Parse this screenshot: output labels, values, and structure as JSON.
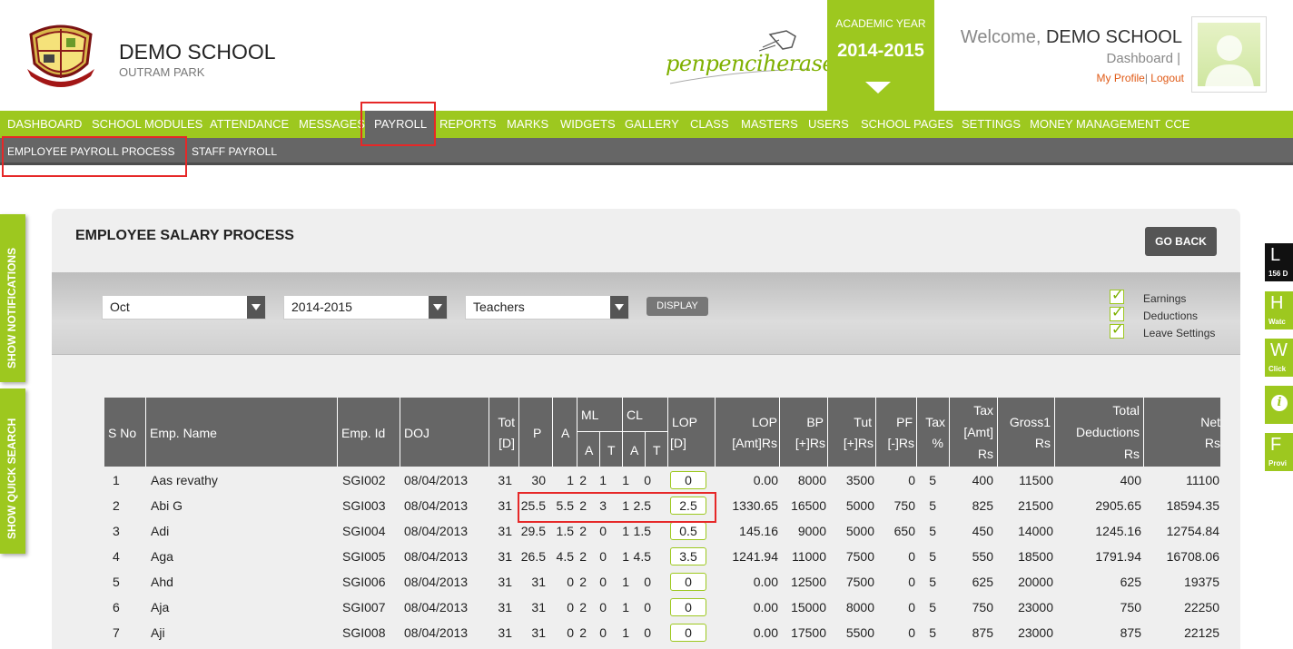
{
  "header": {
    "school_name": "DEMO SCHOOL",
    "school_sub": "OUTRAM PARK",
    "brand": "penpenciheraser",
    "academic_label": "ACADEMIC YEAR",
    "academic_year": "2014-2015",
    "welcome_prefix": "Welcome,",
    "welcome_name": "DEMO SCHOOL",
    "dashboard_link": "Dashboard",
    "my_profile": "My Profile",
    "logout": "Logout"
  },
  "nav": {
    "items": [
      "DASHBOARD",
      "SCHOOL MODULES",
      "ATTENDANCE",
      "MESSAGES",
      "PAYROLL",
      "REPORTS",
      "MARKS",
      "WIDGETS",
      "GALLERY",
      "CLASS",
      "MASTERS",
      "USERS",
      "SCHOOL PAGES",
      "SETTINGS",
      "MONEY MANAGEMENT",
      "CCE"
    ],
    "active": "PAYROLL",
    "sub_items": [
      "EMPLOYEE PAYROLL PROCESS",
      "STAFF PAYROLL"
    ]
  },
  "side_tabs": {
    "notifications": "SHOW NOTIFICATIONS",
    "quick_search": "SHOW QUICK SEARCH"
  },
  "right_tabs": [
    {
      "letter": "L",
      "text": "156 D"
    },
    {
      "letter": "H",
      "text": "Watc"
    },
    {
      "letter": "W",
      "text": "Click"
    },
    {
      "letter": "i",
      "text": ""
    },
    {
      "letter": "F",
      "text": "Provi"
    }
  ],
  "panel": {
    "title": "EMPLOYEE SALARY PROCESS",
    "go_back": "GO BACK",
    "month": "Oct",
    "year": "2014-2015",
    "category": "Teachers",
    "display": "DISPLAY",
    "checkboxes": [
      "Earnings",
      "Deductions",
      "Leave Settings"
    ]
  },
  "table": {
    "headers": {
      "sno": "S No",
      "name": "Emp. Name",
      "empid": "Emp. Id",
      "doj": "DOJ",
      "tot1": "Tot",
      "tot2": "[D]",
      "p": "P",
      "a": "A",
      "ml": "ML",
      "cl": "CL",
      "ml_a": "A",
      "ml_t": "T",
      "cl_a": "A",
      "cl_t": "T",
      "lop1": "LOP",
      "lop2": "[D]",
      "lopamt1": "LOP",
      "lopamt2": "[Amt]Rs",
      "bp1": "BP",
      "bp2": "[+]Rs",
      "tut1": "Tut",
      "tut2": "[+]Rs",
      "pf1": "PF",
      "pf2": "[-]Rs",
      "tax1": "Tax",
      "tax2": "%",
      "taxamt1": "Tax",
      "taxamt2": "[Amt]",
      "taxamt3": "Rs",
      "gross1": "Gross1",
      "gross2": "Rs",
      "ded1": "Total",
      "ded2": "Deductions",
      "ded3": "Rs",
      "net1": "Net",
      "net2": "Rs"
    },
    "rows": [
      [
        "1",
        "Aas revathy",
        "SGI002",
        "08/04/2013",
        "31",
        "30",
        "1",
        "2",
        "1",
        "1",
        "0",
        "0",
        "0.00",
        "8000",
        "3500",
        "0",
        "5",
        "400",
        "11500",
        "400",
        "11100"
      ],
      [
        "2",
        "Abi G",
        "SGI003",
        "08/04/2013",
        "31",
        "25.5",
        "5.5",
        "2",
        "3",
        "1",
        "2.5",
        "2.5",
        "1330.65",
        "16500",
        "5000",
        "750",
        "5",
        "825",
        "21500",
        "2905.65",
        "18594.35"
      ],
      [
        "3",
        "Adi",
        "SGI004",
        "08/04/2013",
        "31",
        "29.5",
        "1.5",
        "2",
        "0",
        "1",
        "1.5",
        "0.5",
        "145.16",
        "9000",
        "5000",
        "650",
        "5",
        "450",
        "14000",
        "1245.16",
        "12754.84"
      ],
      [
        "4",
        "Aga",
        "SGI005",
        "08/04/2013",
        "31",
        "26.5",
        "4.5",
        "2",
        "0",
        "1",
        "4.5",
        "3.5",
        "1241.94",
        "11000",
        "7500",
        "0",
        "5",
        "550",
        "18500",
        "1791.94",
        "16708.06"
      ],
      [
        "5",
        "Ahd",
        "SGI006",
        "08/04/2013",
        "31",
        "31",
        "0",
        "2",
        "0",
        "1",
        "0",
        "0",
        "0.00",
        "12500",
        "7500",
        "0",
        "5",
        "625",
        "20000",
        "625",
        "19375"
      ],
      [
        "6",
        "Aja",
        "SGI007",
        "08/04/2013",
        "31",
        "31",
        "0",
        "2",
        "0",
        "1",
        "0",
        "0",
        "0.00",
        "15000",
        "8000",
        "0",
        "5",
        "750",
        "23000",
        "750",
        "22250"
      ],
      [
        "7",
        "Aji",
        "SGI008",
        "08/04/2013",
        "31",
        "31",
        "0",
        "2",
        "0",
        "1",
        "0",
        "0",
        "0.00",
        "17500",
        "5500",
        "0",
        "5",
        "875",
        "23000",
        "875",
        "22125"
      ]
    ]
  },
  "colors": {
    "accent": "#9dc81f",
    "dark": "#666666",
    "highlight": "#e62828"
  }
}
